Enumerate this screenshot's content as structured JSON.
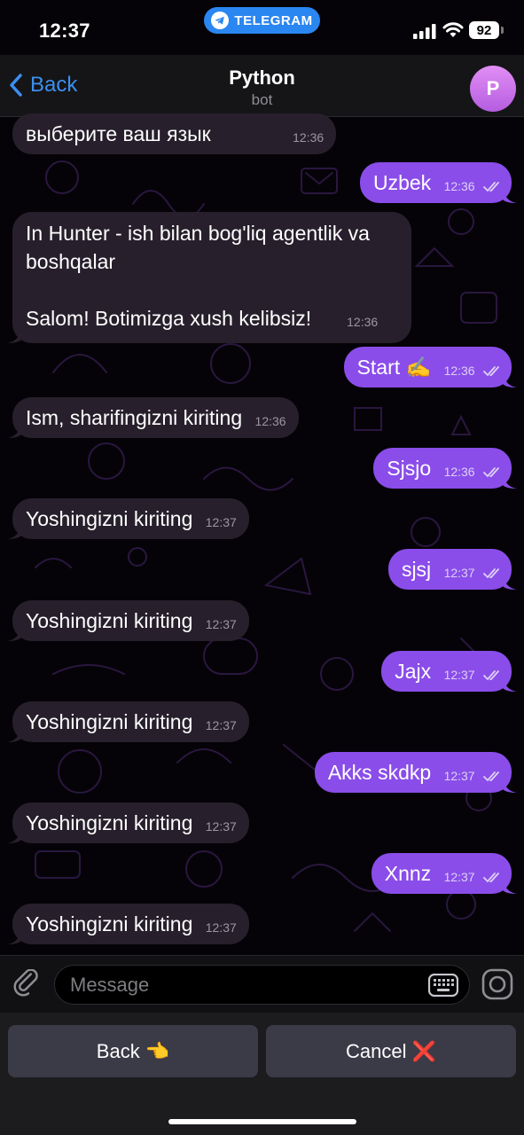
{
  "status_bar": {
    "time": "12:37",
    "app_pill": "TELEGRAM",
    "battery": "92"
  },
  "header": {
    "back_label": "Back",
    "title": "Python",
    "subtitle": "bot",
    "avatar_letter": "P"
  },
  "messages": [
    {
      "dir": "in",
      "text": "выберите ваш язык",
      "time": "12:36"
    },
    {
      "dir": "out",
      "text": "Uzbek",
      "time": "12:36"
    },
    {
      "dir": "in",
      "text": "In Hunter - ish bilan bog'liq agentlik va boshqalar\n\nSalom! Botimizga xush kelibsiz!",
      "time": "12:36"
    },
    {
      "dir": "out",
      "text": "Start ✍️",
      "time": "12:36"
    },
    {
      "dir": "in",
      "text": "Ism, sharifingizni kiriting",
      "time": "12:36"
    },
    {
      "dir": "out",
      "text": "Sjsjo",
      "time": "12:36"
    },
    {
      "dir": "in",
      "text": "Yoshingizni kiriting",
      "time": "12:37"
    },
    {
      "dir": "out",
      "text": "sjsj",
      "time": "12:37"
    },
    {
      "dir": "in",
      "text": "Yoshingizni kiriting",
      "time": "12:37"
    },
    {
      "dir": "out",
      "text": "Jajx",
      "time": "12:37"
    },
    {
      "dir": "in",
      "text": "Yoshingizni kiriting",
      "time": "12:37"
    },
    {
      "dir": "out",
      "text": "Akks skdkp",
      "time": "12:37"
    },
    {
      "dir": "in",
      "text": "Yoshingizni kiriting",
      "time": "12:37"
    },
    {
      "dir": "out",
      "text": "Xnnz",
      "time": "12:37"
    },
    {
      "dir": "in",
      "text": "Yoshingizni kiriting",
      "time": "12:37"
    }
  ],
  "composer": {
    "placeholder": "Message"
  },
  "reply_keyboard": {
    "back": "Back 👈",
    "cancel": "Cancel ❌"
  },
  "colors": {
    "accent": "#3d8ff0",
    "outgoing_bubble": "#8a4de9",
    "incoming_bubble": "#28212d",
    "telegram_pill": "#2a86f0"
  }
}
